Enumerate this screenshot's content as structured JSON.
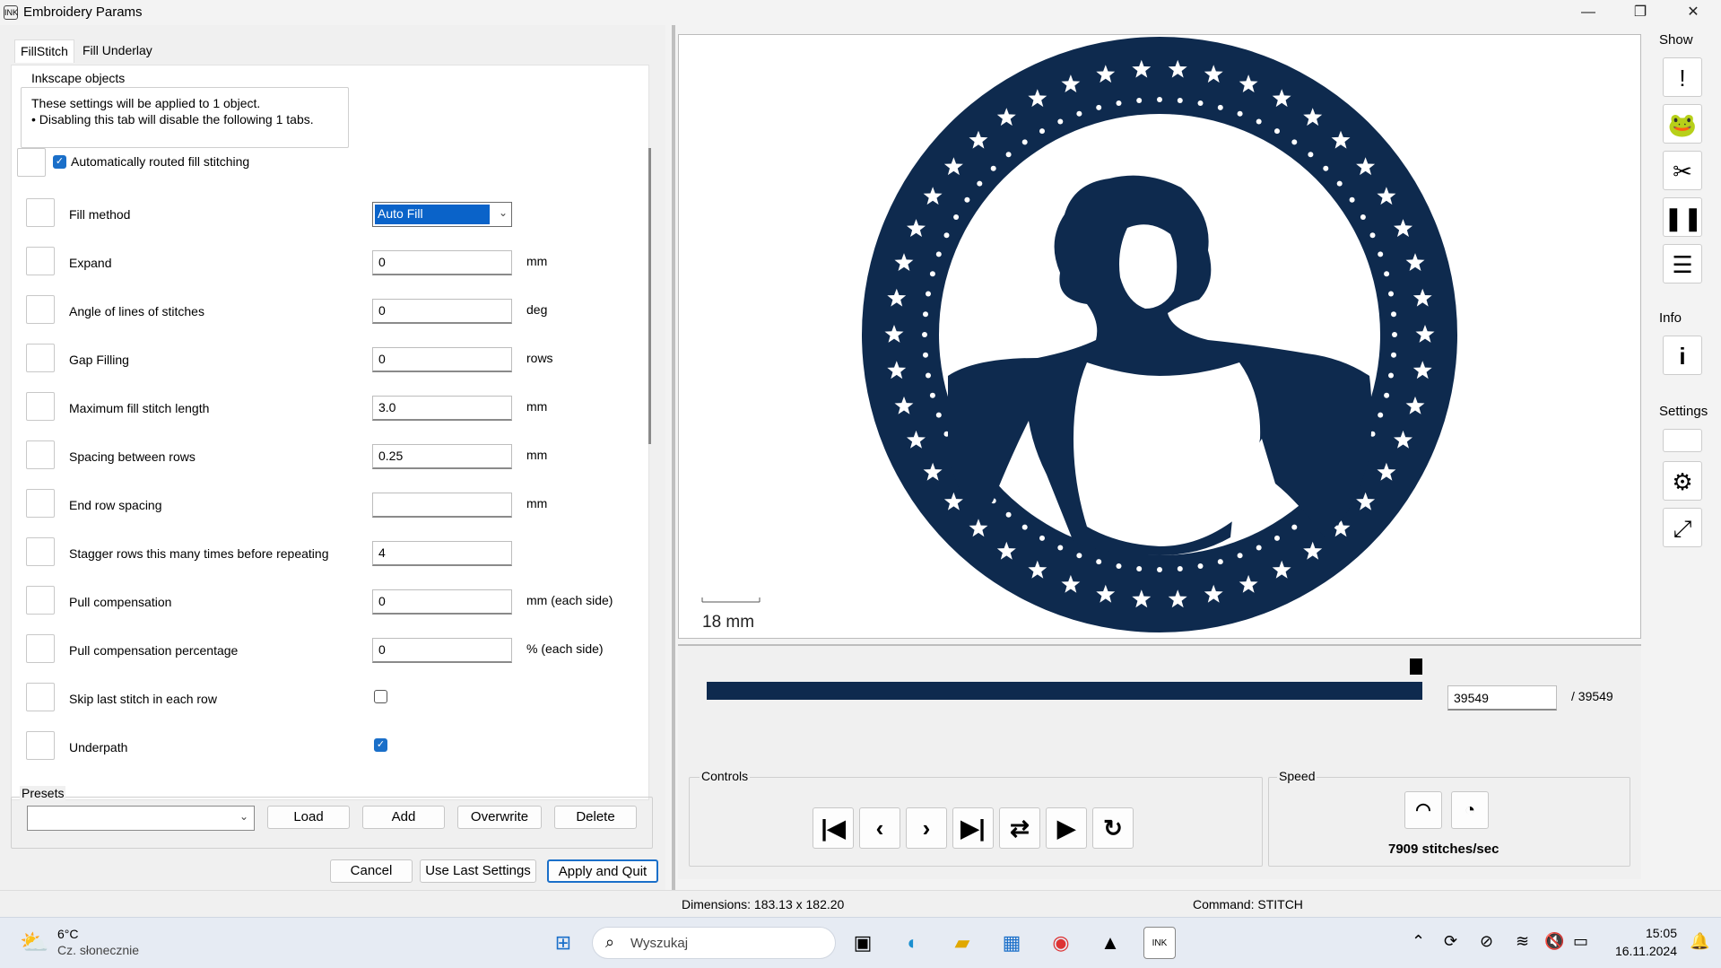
{
  "window": {
    "title": "Embroidery Params",
    "app_icon": "INK"
  },
  "window_controls": {
    "minimize": "—",
    "maximize": "❐",
    "close": "✕"
  },
  "tabs": [
    {
      "label": "FillStitch",
      "active": true
    },
    {
      "label": "Fill Underlay",
      "active": false
    }
  ],
  "inkscape_objects": {
    "legend": "Inkscape objects",
    "line1": "These settings will be applied to 1 object.",
    "line2": "• Disabling this tab will disable the following 1 tabs."
  },
  "auto_route": {
    "label": "Automatically routed fill stitching",
    "checked": true
  },
  "params": [
    {
      "label": "Fill method",
      "value": "Auto Fill",
      "unit": "",
      "kind": "select"
    },
    {
      "label": "Expand",
      "value": "0",
      "unit": "mm",
      "kind": "input"
    },
    {
      "label": "Angle of lines of stitches",
      "value": "0",
      "unit": "deg",
      "kind": "input"
    },
    {
      "label": "Gap Filling",
      "value": "0",
      "unit": "rows",
      "kind": "input"
    },
    {
      "label": "Maximum fill stitch length",
      "value": "3.0",
      "unit": "mm",
      "kind": "input"
    },
    {
      "label": "Spacing between rows",
      "value": "0.25",
      "unit": "mm",
      "kind": "input"
    },
    {
      "label": "End row spacing",
      "value": "",
      "unit": "mm",
      "kind": "input"
    },
    {
      "label": "Stagger rows this many times before repeating",
      "value": "4",
      "unit": "",
      "kind": "input"
    },
    {
      "label": "Pull compensation",
      "value": "0",
      "unit": "mm (each side)",
      "kind": "input"
    },
    {
      "label": "Pull compensation percentage",
      "value": "0",
      "unit": "% (each side)",
      "kind": "input"
    },
    {
      "label": "Skip last stitch in each row",
      "value": false,
      "unit": "",
      "kind": "checkbox"
    },
    {
      "label": "Underpath",
      "value": true,
      "unit": "",
      "kind": "checkbox"
    }
  ],
  "presets": {
    "legend": "Presets",
    "selected": "",
    "load": "Load",
    "add": "Add",
    "overwrite": "Overwrite",
    "delete": "Delete"
  },
  "footer_buttons": {
    "cancel": "Cancel",
    "use_last": "Use Last Settings",
    "apply": "Apply and Quit"
  },
  "preview": {
    "scale_label": "18 mm",
    "design_color": "#0e2a4e"
  },
  "slider": {
    "progress": 1.0,
    "current": "39549",
    "total": "/ 39549"
  },
  "controls": {
    "legend": "Controls",
    "buttons": [
      "first-stitch",
      "previous-stitch",
      "next-stitch",
      "last-stitch",
      "toggle-direction",
      "play",
      "restart"
    ]
  },
  "speed": {
    "legend": "Speed",
    "value": "7909 stitches/sec"
  },
  "sidebar": {
    "show_label": "Show",
    "info_label": "Info",
    "settings_label": "Settings"
  },
  "status": {
    "dimensions": "Dimensions: 183.13 x 182.20",
    "command": "Command: STITCH"
  },
  "taskbar": {
    "weather_temp": "6°C",
    "weather_desc": "Cz. słonecznie",
    "search_placeholder": "Wyszukaj",
    "time": "15:05",
    "date": "16.11.2024"
  }
}
